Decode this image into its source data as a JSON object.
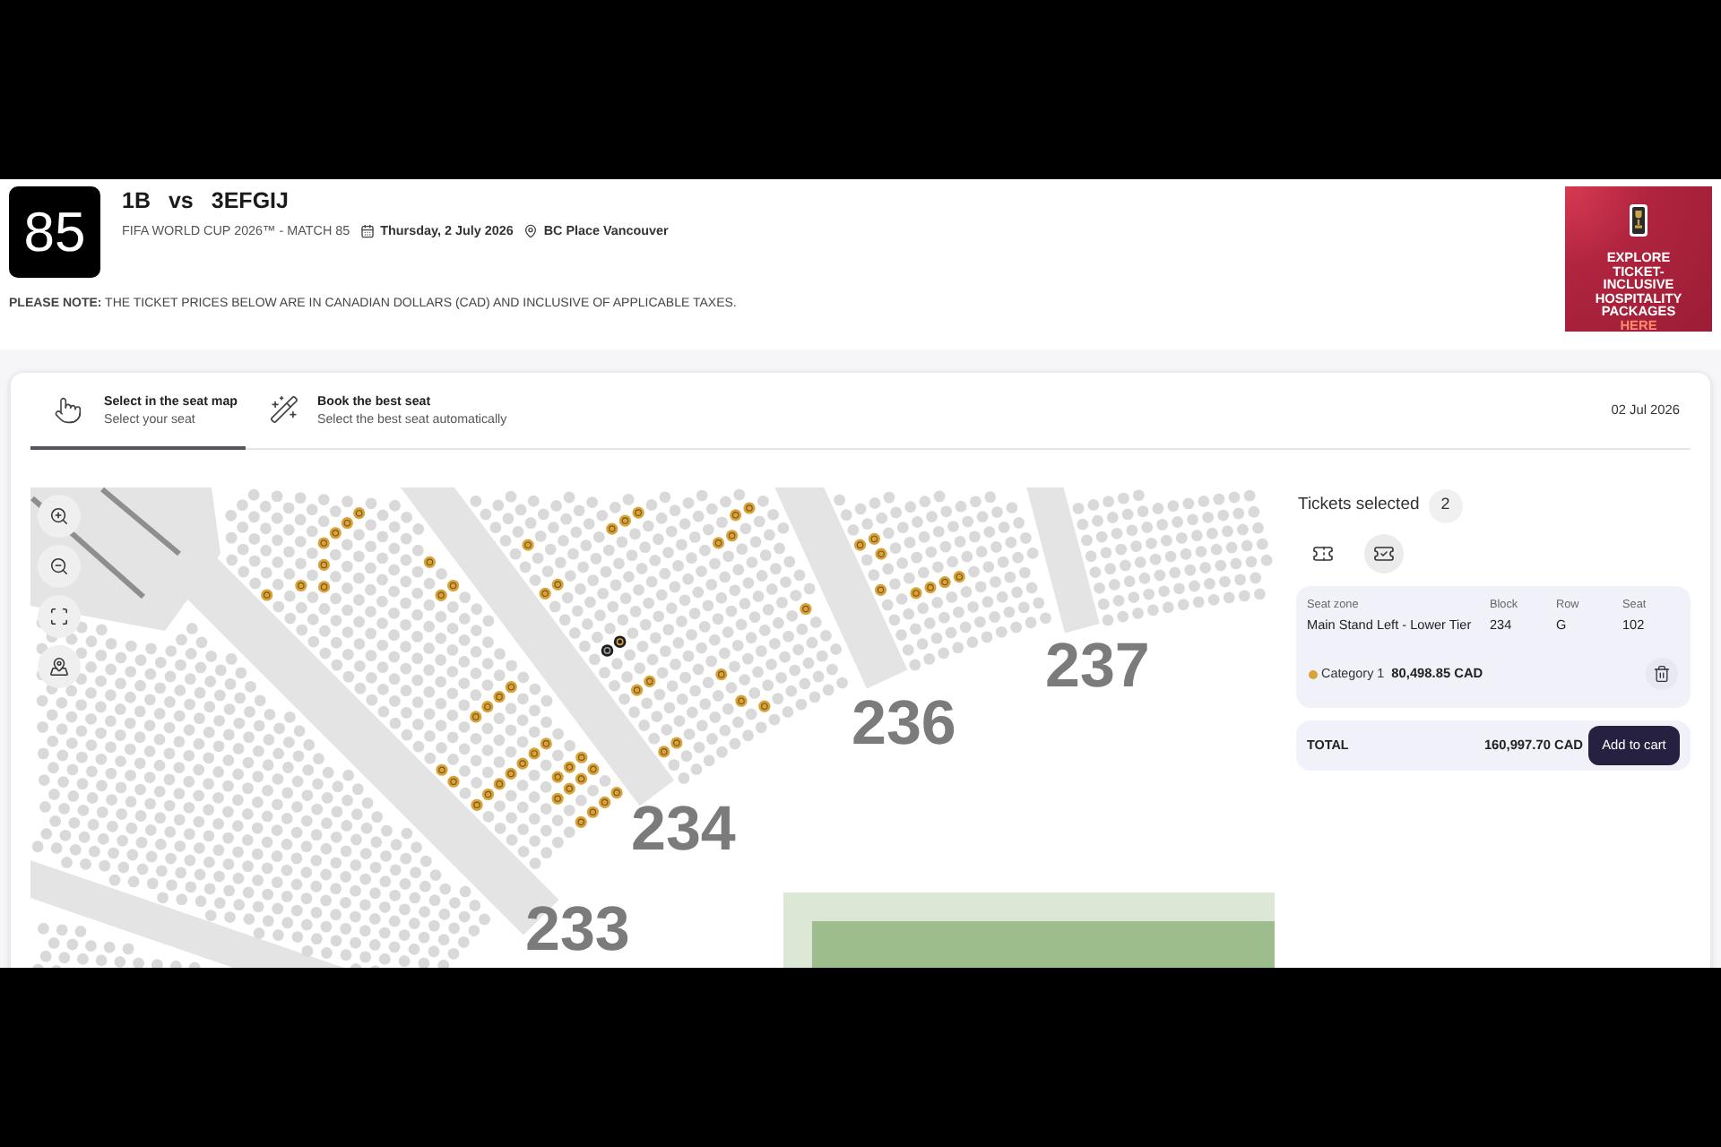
{
  "match": {
    "number": "85",
    "home": "1B",
    "versus": "vs",
    "away": "3EFGIJ",
    "competition": "FIFA WORLD CUP 2026™ - MATCH 85",
    "date": "Thursday, 2 July 2026",
    "venue": "BC Place Vancouver"
  },
  "notice": "**PLEASE NOTE:** THE TICKET PRICES BELOW ARE IN CANADIAN DOLLARS (CAD) AND INCLUSIVE OF APPLICABLE TAXES.",
  "promo": {
    "lines": [
      "EXPLORE",
      "TICKET-",
      "INCLUSIVE",
      "HOSPITALITY",
      "PACKAGES"
    ],
    "highlight": "HERE"
  },
  "tabs": [
    {
      "title": "Select in the seat map",
      "subtitle": "Select your seat",
      "selected": true
    },
    {
      "title": "Book the best seat",
      "subtitle": "Select the best seat automatically",
      "selected": false
    }
  ],
  "event_date": "02 Jul 2026",
  "seat_map": {
    "blocks": [
      "233",
      "234",
      "236",
      "237"
    ]
  },
  "cart": {
    "title": "Tickets selected",
    "count": "2",
    "views": [
      {
        "selected": false
      },
      {
        "selected": true
      }
    ],
    "ticket": {
      "columns": [
        {
          "label": "Seat zone",
          "value": "Main Stand Left - Lower Tier"
        },
        {
          "label": "Block",
          "value": "234"
        },
        {
          "label": "Row",
          "value": "G"
        },
        {
          "label": "Seat",
          "value": "102"
        }
      ],
      "category": {
        "name": "Category 1",
        "color": "#d9a23a"
      },
      "price": "80,498.85 CAD"
    },
    "total": {
      "label": "TOTAL",
      "amount": "160,997.70 CAD",
      "action": "Add to cart"
    }
  }
}
